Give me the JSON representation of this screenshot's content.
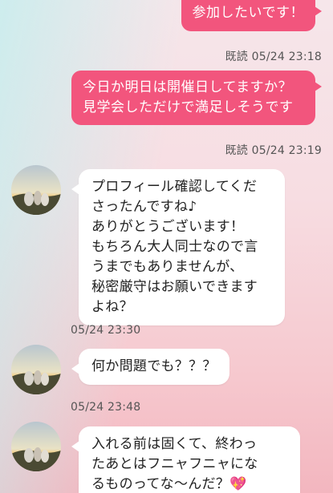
{
  "messages": [
    {
      "type": "outgoing",
      "text": "参加したいです！",
      "status": "既読 05/24 23:18"
    },
    {
      "type": "outgoing",
      "text": "今日か明日は開催日してますか？\n見学会しただけで満足しそうです",
      "status": "既読 05/24 23:19"
    },
    {
      "type": "incoming",
      "text": "プロフィール確認してくだ\nさったんですね♪\nありがとうございます！\nもちろん大人同士なので言\nうまでもありませんが、\n秘密厳守はお願いできます\nよね？",
      "time": "05/24 23:30"
    },
    {
      "type": "incoming",
      "text": "何か問題でも？？？",
      "time": "05/24 23:48"
    },
    {
      "type": "incoming",
      "text": "入れる前は固くて、終わっ\nたあとはフニャフニャにな\nるものってな～んだ？💖",
      "time": ""
    }
  ],
  "colors": {
    "outgoing_bubble": "#f2557d",
    "incoming_bubble": "#ffffff",
    "background_top": "#f6e6ea",
    "background_bottom": "#f3b6bf"
  },
  "icons": {
    "avatar": "avatar-photo"
  }
}
